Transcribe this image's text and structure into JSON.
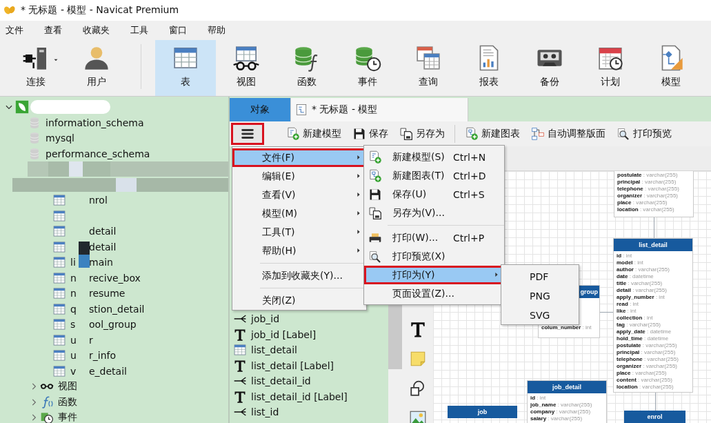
{
  "window": {
    "title": "* 无标题 - 模型 - Navicat Premium"
  },
  "menubar": [
    "文件",
    "查看",
    "收藏夹",
    "工具",
    "窗口",
    "帮助"
  ],
  "toolbar": [
    {
      "kind": "connect",
      "label": "连接",
      "selected": false,
      "dropdown": true
    },
    {
      "kind": "user",
      "label": "用户",
      "selected": false,
      "dropdown": false
    },
    {
      "kind": "separator"
    },
    {
      "kind": "table",
      "label": "表",
      "selected": true,
      "dropdown": false
    },
    {
      "kind": "view",
      "label": "视图",
      "selected": false,
      "dropdown": false
    },
    {
      "kind": "function",
      "label": "函数",
      "selected": false,
      "dropdown": false
    },
    {
      "kind": "event",
      "label": "事件",
      "selected": false,
      "dropdown": false
    },
    {
      "kind": "query",
      "label": "查询",
      "selected": false,
      "dropdown": false
    },
    {
      "kind": "report",
      "label": "报表",
      "selected": false,
      "dropdown": false
    },
    {
      "kind": "backup",
      "label": "备份",
      "selected": false,
      "dropdown": false
    },
    {
      "kind": "schedule",
      "label": "计划",
      "selected": false,
      "dropdown": false
    },
    {
      "kind": "model",
      "label": "模型",
      "selected": false,
      "dropdown": false
    }
  ],
  "navigator": {
    "root": {
      "kind": "connection",
      "redacted": true,
      "expanded": true,
      "children": [
        {
          "kind": "database",
          "label": "information_schema"
        },
        {
          "kind": "database",
          "label": "mysql"
        },
        {
          "kind": "database",
          "label": "performance_schema"
        },
        {
          "kind": "database",
          "redacted": true,
          "children": [
            {
              "kind": "folder",
              "redacted": true,
              "children": [
                {
                  "kind": "table",
                  "suffix": "nrol"
                },
                {
                  "kind": "table"
                },
                {
                  "kind": "table",
                  "suffix": "detail"
                },
                {
                  "kind": "table",
                  "suffix": "detail"
                },
                {
                  "kind": "table",
                  "prefix": "li",
                  "suffix": "main"
                },
                {
                  "kind": "table",
                  "prefix": "n",
                  "suffix": "recive_box"
                },
                {
                  "kind": "table",
                  "prefix": "n",
                  "suffix": "resume"
                },
                {
                  "kind": "table",
                  "prefix": "q",
                  "suffix": "stion_detail"
                },
                {
                  "kind": "table",
                  "prefix": "s",
                  "suffix": "ool_group"
                },
                {
                  "kind": "table",
                  "prefix": "u",
                  "suffix": "r"
                },
                {
                  "kind": "table",
                  "prefix": "u",
                  "suffix": "r_info"
                },
                {
                  "kind": "table",
                  "prefix": "v",
                  "suffix": "e_detail"
                }
              ]
            },
            {
              "kind": "views",
              "label": "视图",
              "expanded": false
            },
            {
              "kind": "functions",
              "label": "函数",
              "expanded": false
            },
            {
              "kind": "events",
              "label": "事件",
              "expanded": false
            }
          ]
        }
      ]
    }
  },
  "tabs": [
    {
      "kind": "objects",
      "label": "对象",
      "selected": true
    },
    {
      "kind": "document",
      "label": "* 无标题 - 模型",
      "selected": false
    }
  ],
  "model_toolbar": [
    {
      "kind": "menu",
      "highlighted": true
    },
    {
      "kind": "new-model",
      "label": "新建模型",
      "highlighted": false
    },
    {
      "kind": "save",
      "label": "保存",
      "highlighted": false
    },
    {
      "kind": "save-as",
      "label": "另存为",
      "highlighted": false
    },
    {
      "kind": "separator"
    },
    {
      "kind": "new-diagram",
      "label": "新建图表",
      "highlighted": false
    },
    {
      "kind": "auto-layout",
      "label": "自动调整版面",
      "highlighted": false
    },
    {
      "kind": "print-preview",
      "label": "打印预览",
      "highlighted": false
    }
  ],
  "objects": [
    {
      "kind": "relation",
      "label": "job_id"
    },
    {
      "kind": "label",
      "label": "job_id [Label]"
    },
    {
      "kind": "table",
      "label": "list_detail"
    },
    {
      "kind": "label",
      "label": "list_detail [Label]"
    },
    {
      "kind": "relation",
      "label": "list_detail_id"
    },
    {
      "kind": "label",
      "label": "list_detail_id [Label]"
    },
    {
      "kind": "relation",
      "label": "list_id"
    }
  ],
  "palette": [
    {
      "kind": "text"
    },
    {
      "kind": "note"
    },
    {
      "kind": "shape"
    },
    {
      "kind": "image"
    }
  ],
  "diagram": {
    "entities": [
      {
        "fields": [
          "**postulate** : varchar(255)",
          "**principal** : varchar(255)",
          "**telephone** : varchar(255)",
          "**organizer** : varchar(255)",
          "**place** : varchar(255)",
          "**location** : varchar(255)"
        ]
      },
      {
        "title": "list_detail",
        "fields": [
          "**id** : int",
          "**model** : int",
          "**author** : varchar(255)",
          "**date** : datetime",
          "**title** : varchar(255)",
          "**detail** : varchar(255)",
          "**apply_number** : int",
          "**read** : int",
          "**like** : int",
          "**collection** : int",
          "**tag** : varchar(255)",
          "**apply_date** : datetime",
          "**hold_time** : datetime",
          "**postulate** : varchar(255)",
          "**principal** : varchar(255)",
          "**telephone** : varchar(255)",
          "**organizer** : varchar(255)",
          "**place** : varchar(255)",
          "**content** : varchar(255)",
          "**location** : varchar(255)"
        ]
      },
      {
        "title": "group",
        "fields": [
          "**colum_number** : int"
        ]
      },
      {
        "title": "job_detail",
        "fields": [
          "**id** : int",
          "**job_name** : varchar(255)",
          "**company** : varchar(255)",
          "**salary** : varchar(255)"
        ]
      },
      {
        "title": "job"
      },
      {
        "title": "enrol"
      }
    ]
  },
  "main_menu": {
    "items": [
      {
        "kind": "item",
        "label": "文件(F)",
        "selected": true,
        "highlighted": true,
        "submenu": true
      },
      {
        "kind": "item",
        "label": "编辑(E)",
        "selected": false,
        "highlighted": false,
        "submenu": true
      },
      {
        "kind": "item",
        "label": "查看(V)",
        "selected": false,
        "highlighted": false,
        "submenu": true
      },
      {
        "kind": "item",
        "label": "模型(M)",
        "selected": false,
        "highlighted": false,
        "submenu": true
      },
      {
        "kind": "item",
        "label": "工具(T)",
        "selected": false,
        "highlighted": false,
        "submenu": true
      },
      {
        "kind": "item",
        "label": "帮助(H)",
        "selected": false,
        "highlighted": false,
        "submenu": true
      },
      {
        "kind": "separator"
      },
      {
        "kind": "item",
        "label": "添加到收藏夹(Y)...",
        "selected": false,
        "highlighted": false,
        "submenu": false
      },
      {
        "kind": "separator"
      },
      {
        "kind": "item",
        "label": "关闭(Z)",
        "selected": false,
        "highlighted": false,
        "submenu": false
      }
    ]
  },
  "file_menu": {
    "items": [
      {
        "kind": "new-model",
        "label": "新建模型(S)",
        "shortcut": "Ctrl+N",
        "selected": false,
        "highlighted": false,
        "submenu": false
      },
      {
        "kind": "new-diagram",
        "label": "新建图表(T)",
        "shortcut": "Ctrl+D",
        "selected": false,
        "highlighted": false,
        "submenu": false
      },
      {
        "kind": "save",
        "label": "保存(U)",
        "shortcut": "Ctrl+S",
        "selected": false,
        "highlighted": false,
        "submenu": false
      },
      {
        "kind": "save-as",
        "label": "另存为(V)...",
        "selected": false,
        "highlighted": false,
        "submenu": false
      },
      {
        "kind": "separator"
      },
      {
        "kind": "print",
        "label": "打印(W)...",
        "shortcut": "Ctrl+P",
        "selected": false,
        "highlighted": false,
        "submenu": false
      },
      {
        "kind": "print-preview",
        "label": "打印预览(X)",
        "selected": false,
        "highlighted": false,
        "submenu": false
      },
      {
        "kind": "item",
        "label": "打印为(Y)",
        "selected": true,
        "highlighted": true,
        "submenu": true
      },
      {
        "kind": "item",
        "label": "页面设置(Z)...",
        "selected": false,
        "highlighted": false,
        "submenu": false
      }
    ]
  },
  "print_as_menu": {
    "items": [
      {
        "kind": "item",
        "label": "PDF",
        "selected": false,
        "highlighted": false,
        "submenu": false
      },
      {
        "kind": "item",
        "label": "PNG",
        "selected": false,
        "highlighted": false,
        "submenu": false
      },
      {
        "kind": "item",
        "label": "SVG",
        "selected": false,
        "highlighted": false,
        "submenu": false
      }
    ]
  }
}
